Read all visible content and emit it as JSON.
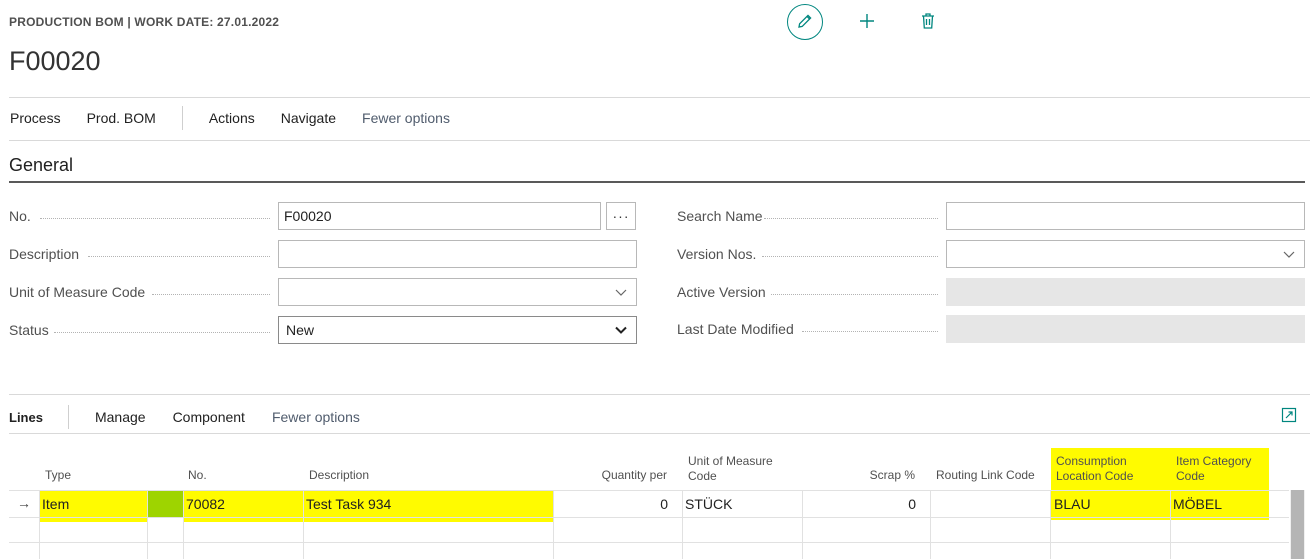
{
  "header": {
    "caption": "PRODUCTION BOM | WORK DATE: 27.01.2022",
    "title": "F00020",
    "edit_icon": "pencil-icon",
    "new_icon": "plus-icon",
    "delete_icon": "trash-icon"
  },
  "actionbar": {
    "items": [
      "Process",
      "Prod. BOM",
      "Actions",
      "Navigate",
      "Fewer options"
    ]
  },
  "general": {
    "title": "General",
    "left_fields": [
      {
        "label": "No.",
        "value": "F00020"
      },
      {
        "label": "Description",
        "value": ""
      },
      {
        "label": "Unit of Measure Code",
        "value": ""
      },
      {
        "label": "Status",
        "value": "New"
      }
    ],
    "right_fields": [
      {
        "label": "Search Name",
        "value": ""
      },
      {
        "label": "Version Nos.",
        "value": ""
      },
      {
        "label": "Active Version",
        "value": ""
      },
      {
        "label": "Last Date Modified",
        "value": ""
      }
    ],
    "assist_label": "···"
  },
  "lines": {
    "title": "Lines",
    "actions": [
      "Manage",
      "Component",
      "Fewer options"
    ],
    "expand_icon": "expand-icon",
    "columns": {
      "type": "Type",
      "no": "No.",
      "description": "Description",
      "quantity_per": "Quantity per",
      "uom_line1": "Unit of Measure",
      "uom_line2": "Code",
      "scrap": "Scrap %",
      "routing_link": "Routing Link Code",
      "consumption_line1": "Consumption",
      "consumption_line2": "Location Code",
      "item_category_line1": "Item Category",
      "item_category_line2": "Code"
    },
    "rows": [
      {
        "indicator": "→",
        "type": "Item",
        "no": "70082",
        "description": "Test Task 934",
        "quantity_per": "0",
        "uom": "STÜCK",
        "scrap": "0",
        "routing_link": "",
        "consumption_location": "BLAU",
        "item_category": "MÖBEL"
      }
    ]
  },
  "colors": {
    "accent": "#00867f",
    "highlight": "#fffb00",
    "variant_cell": "#9ed400"
  }
}
